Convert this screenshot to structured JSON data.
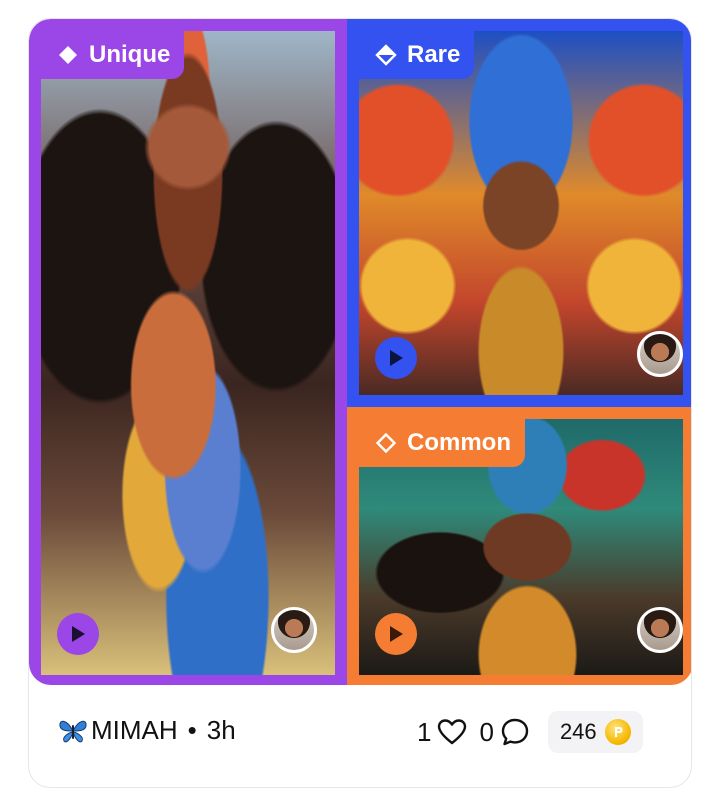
{
  "tiles": [
    {
      "rarity": "Unique",
      "color": "#9b46e6"
    },
    {
      "rarity": "Rare",
      "color": "#3452f0"
    },
    {
      "rarity": "Common",
      "color": "#f57d33"
    }
  ],
  "post": {
    "author_emoji": "butterfly-icon",
    "author": "MIMAH",
    "separator": "•",
    "time": "3h",
    "likes": "1",
    "comments": "0",
    "coins": "246"
  }
}
